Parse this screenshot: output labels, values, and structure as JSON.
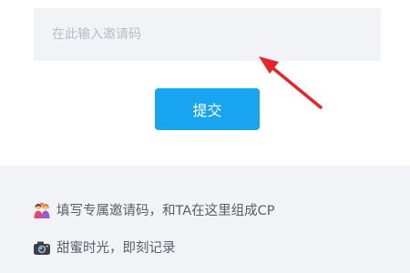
{
  "invite": {
    "placeholder": "在此输入邀请码",
    "value": ""
  },
  "submit_label": "提交",
  "info": {
    "items": [
      {
        "icon": "couple-icon",
        "text": "填写专属邀请码，和TA在这里组成CP"
      },
      {
        "icon": "camera-icon",
        "text": "甜蜜时光，即刻记录"
      }
    ]
  },
  "colors": {
    "accent": "#18a4ee",
    "arrow": "#e8242a",
    "panel_bg": "#f2f3f6"
  }
}
